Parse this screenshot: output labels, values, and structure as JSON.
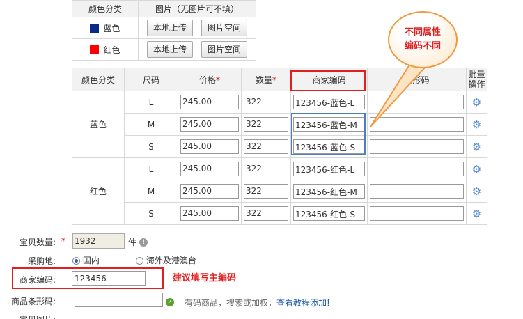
{
  "color_table": {
    "header_color": "颜色分类",
    "header_image": "图片（无图片可不填）",
    "rows": [
      {
        "swatch": "#0a2a8a",
        "name": "蓝色",
        "upload_label": "本地上传",
        "space_label": "图片空间"
      },
      {
        "swatch": "#ff0000",
        "name": "红色",
        "upload_label": "本地上传",
        "space_label": "图片空间"
      }
    ]
  },
  "sku_table": {
    "headers": {
      "color": "颜色分类",
      "size": "尺码",
      "price": "价格",
      "qty": "数量",
      "code": "商家编码",
      "barcode": "条形码",
      "batch_line1": "批量",
      "batch_line2": "操作",
      "required_mark": "*"
    },
    "groups": [
      {
        "color": "蓝色",
        "rows": [
          {
            "size": "L",
            "price": "245.00",
            "qty": "322",
            "code": "123456-蓝色-L",
            "barcode": ""
          },
          {
            "size": "M",
            "price": "245.00",
            "qty": "322",
            "code": "123456-蓝色-M",
            "barcode": ""
          },
          {
            "size": "S",
            "price": "245.00",
            "qty": "322",
            "code": "123456-蓝色-S",
            "barcode": ""
          }
        ]
      },
      {
        "color": "红色",
        "rows": [
          {
            "size": "L",
            "price": "245.00",
            "qty": "322",
            "code": "123456-红色-L",
            "barcode": ""
          },
          {
            "size": "M",
            "price": "245.00",
            "qty": "322",
            "code": "123456-红色-M",
            "barcode": ""
          },
          {
            "size": "S",
            "price": "245.00",
            "qty": "322",
            "code": "123456-红色-S",
            "barcode": ""
          }
        ]
      }
    ],
    "gear_icon": "⚙"
  },
  "annotation": {
    "bubble_line1": "不同属性",
    "bubble_line2": "编码不同",
    "hint": "建议填写主编码"
  },
  "form": {
    "qty_label": "宝贝数量:",
    "qty_required": "*",
    "qty_value": "1932",
    "qty_unit": "件",
    "origin_label": "采购地:",
    "origin_domestic": "国内",
    "origin_overseas": "海外及港澳台",
    "code_label": "商家编码:",
    "code_value": "123456",
    "barcode_label": "商品条形码:",
    "barcode_value": "",
    "barcode_hint": "有码商品，搜索或加权，",
    "barcode_link": "查看教程添加!",
    "next_label": "宝贝图片:"
  },
  "colors": {
    "red_highlight": "#e02020",
    "blue_highlight": "#4a7ec0",
    "link": "#1e5aa8"
  }
}
